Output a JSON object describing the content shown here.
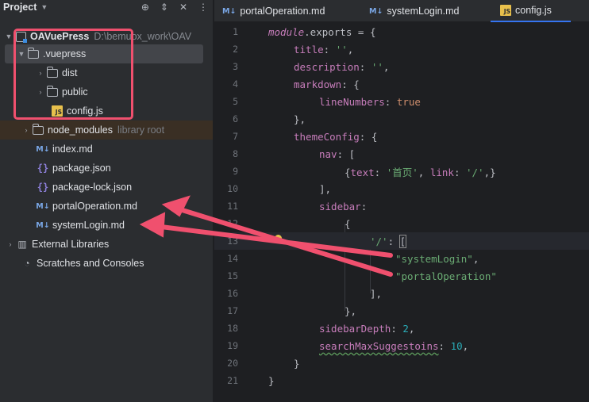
{
  "project_panel": {
    "title": "Project",
    "tool_icons": [
      "target-icon",
      "expand-collapse-icon",
      "close-icon",
      "more-icon"
    ]
  },
  "tree": {
    "root": {
      "label": "OAVuePress",
      "path": "D:\\bemuox_work\\OAV"
    },
    "vuepress": ".vuepress",
    "dist": "dist",
    "public": "public",
    "config": "config.js",
    "node_modules": "node_modules",
    "node_modules_hint": "library root",
    "index": "index.md",
    "package": "package.json",
    "package_lock": "package-lock.json",
    "portal": "portalOperation.md",
    "system": "systemLogin.md",
    "external": "External Libraries",
    "scratches": "Scratches and Consoles"
  },
  "tabs": [
    {
      "label": "portalOperation.md",
      "icon": "M↓"
    },
    {
      "label": "systemLogin.md",
      "icon": "M↓"
    },
    {
      "label": "config.js",
      "icon": "JS",
      "active": true
    }
  ],
  "editor": {
    "line_numbers": [
      "1",
      "2",
      "3",
      "4",
      "5",
      "6",
      "7",
      "8",
      "9",
      "10",
      "11",
      "12",
      "13",
      "14",
      "15",
      "16",
      "17",
      "18",
      "19",
      "20",
      "21"
    ],
    "lines": {
      "l1_kw": "module",
      "l1_rest": ".exports = {",
      "l2_key": "title",
      "l2_val": "''",
      "l3_key": "description",
      "l3_val": "''",
      "l4_key": "markdown",
      "l5_key": "lineNumbers",
      "l5_val": "true",
      "l6": "},",
      "l7_key": "themeConfig",
      "l8_key": "nav",
      "l9_k1": "text",
      "l9_v1": "'首页'",
      "l9_k2": "link",
      "l9_v2": "'/'",
      "l10": "],",
      "l11_key": "sidebar",
      "l12": "{",
      "l13_key": "'/'",
      "l14_val": "\"systemLogin\"",
      "l15_val": "\"portalOperation\"",
      "l16": "],",
      "l17": "},",
      "l18_key": "sidebarDepth",
      "l18_val": "2",
      "l19_key": "searchMaxSuggestoins",
      "l19_val": "10",
      "l20": "}",
      "l21": "}"
    }
  },
  "annotations": {
    "highlight_color": "#f0506e"
  }
}
